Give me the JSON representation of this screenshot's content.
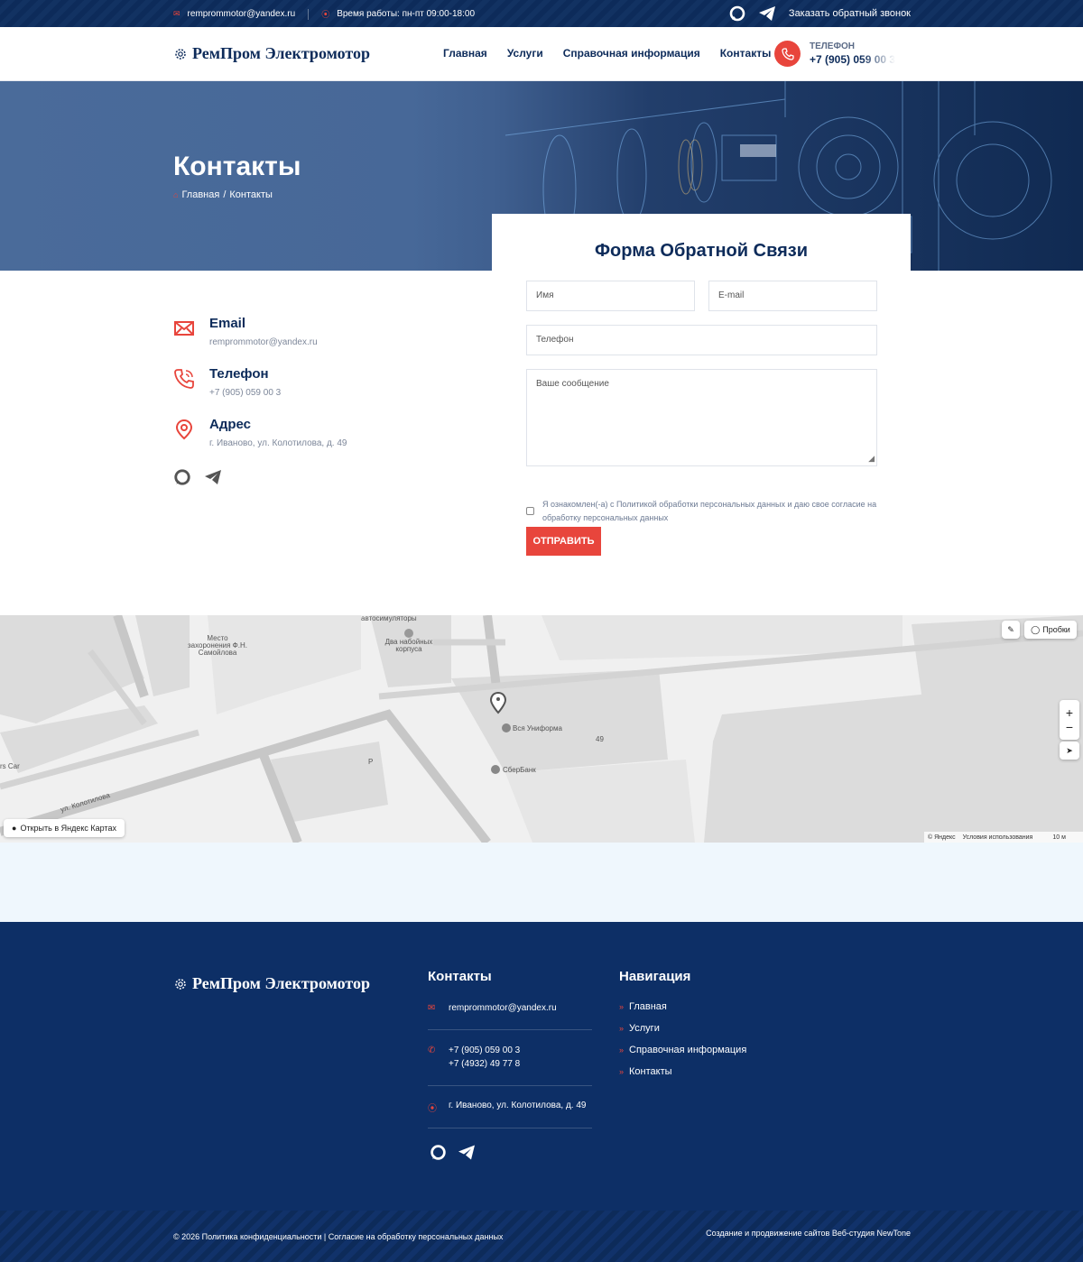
{
  "topbar": {
    "email": "remprommotor@yandex.ru",
    "hours": "Время работы: пн-пт 09:00-18:00",
    "callback": "Заказать обратный звонок"
  },
  "header": {
    "logo": "РемПром Электромотор",
    "nav": [
      "Главная",
      "Услуги",
      "Справочная информация",
      "Контакты"
    ],
    "phone_label": "ТЕЛЕФОН",
    "phone": "+7 (905) 059 00 3"
  },
  "hero": {
    "title": "Контакты",
    "breadcrumb_home": "Главная",
    "breadcrumb_sep": "/",
    "breadcrumb_current": "Контакты"
  },
  "contacts": {
    "email_title": "Email",
    "email_value": "remprommotor@yandex.ru",
    "phone_title": "Телефон",
    "phone_value": "+7 (905) 059 00 3",
    "address_title": "Адрес",
    "address_value": "г. Иваново, ул. Колотилова, д. 49"
  },
  "form": {
    "title": "Форма Обратной Связи",
    "name_placeholder": "Имя",
    "email_placeholder": "E-mail",
    "phone_placeholder": "Телефон",
    "message_placeholder": "Ваше сообщение",
    "consent": "Я ознакомлен(-а) с Политикой обработки персональных данных и даю свое согласие на обработку персональных данных",
    "submit": "ОТПРАВИТЬ"
  },
  "map": {
    "traffic": "Пробки",
    "open_link": "Открыть в Яндекс Картах",
    "copyright": "© Яндекс",
    "terms": "Условия использования",
    "scale": "10 м",
    "labels": {
      "autosim": "автосимуляторы",
      "burial": "Место захоронения Ф.Н. Самойлова",
      "factory": "Два набойных корпуса",
      "uniform": "Вся Униформа",
      "sber": "СберБанк",
      "house": "49",
      "street": "ул. Колотилова",
      "parking": "P",
      "cars": "rs Car"
    }
  },
  "footer": {
    "logo": "РемПром Электромотор",
    "contacts_title": "Контакты",
    "email": "remprommotor@yandex.ru",
    "phone1": "+7 (905) 059 00 3",
    "phone2": "+7 (4932) 49 77 8",
    "address": "г. Иваново, ул. Колотилова, д. 49",
    "nav_title": "Навигация",
    "nav": [
      "Главная",
      "Услуги",
      "Справочная информация",
      "Контакты"
    ],
    "copyright": "© 2026 Политика конфиденциальности | Согласие на обработку персональных данных",
    "credit": "Создание и продвижение сайтов Веб-студия NewTone"
  },
  "colors": {
    "accent": "#e8453c",
    "navy": "#0d2b5a",
    "footer_bg": "#0d2f66",
    "band": "#eff7fd"
  }
}
